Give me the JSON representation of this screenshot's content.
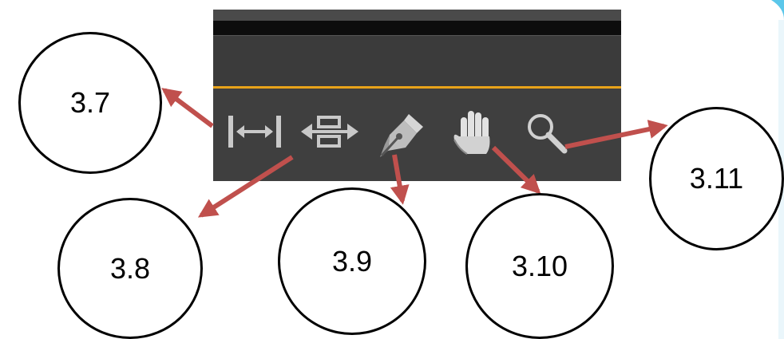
{
  "toolbar": {
    "accent_color": "#e8a31a",
    "tools": [
      {
        "id": "3.7",
        "icon": "fit-width-icon"
      },
      {
        "id": "3.8",
        "icon": "move-arrows-icon"
      },
      {
        "id": "3.9",
        "icon": "pen-icon"
      },
      {
        "id": "3.10",
        "icon": "hand-icon"
      },
      {
        "id": "3.11",
        "icon": "zoom-icon"
      }
    ]
  },
  "callouts": {
    "c1": "3.7",
    "c2": "3.8",
    "c3": "3.9",
    "c4": "3.10",
    "c5": "3.11"
  },
  "arrow_color": "#c0504d"
}
